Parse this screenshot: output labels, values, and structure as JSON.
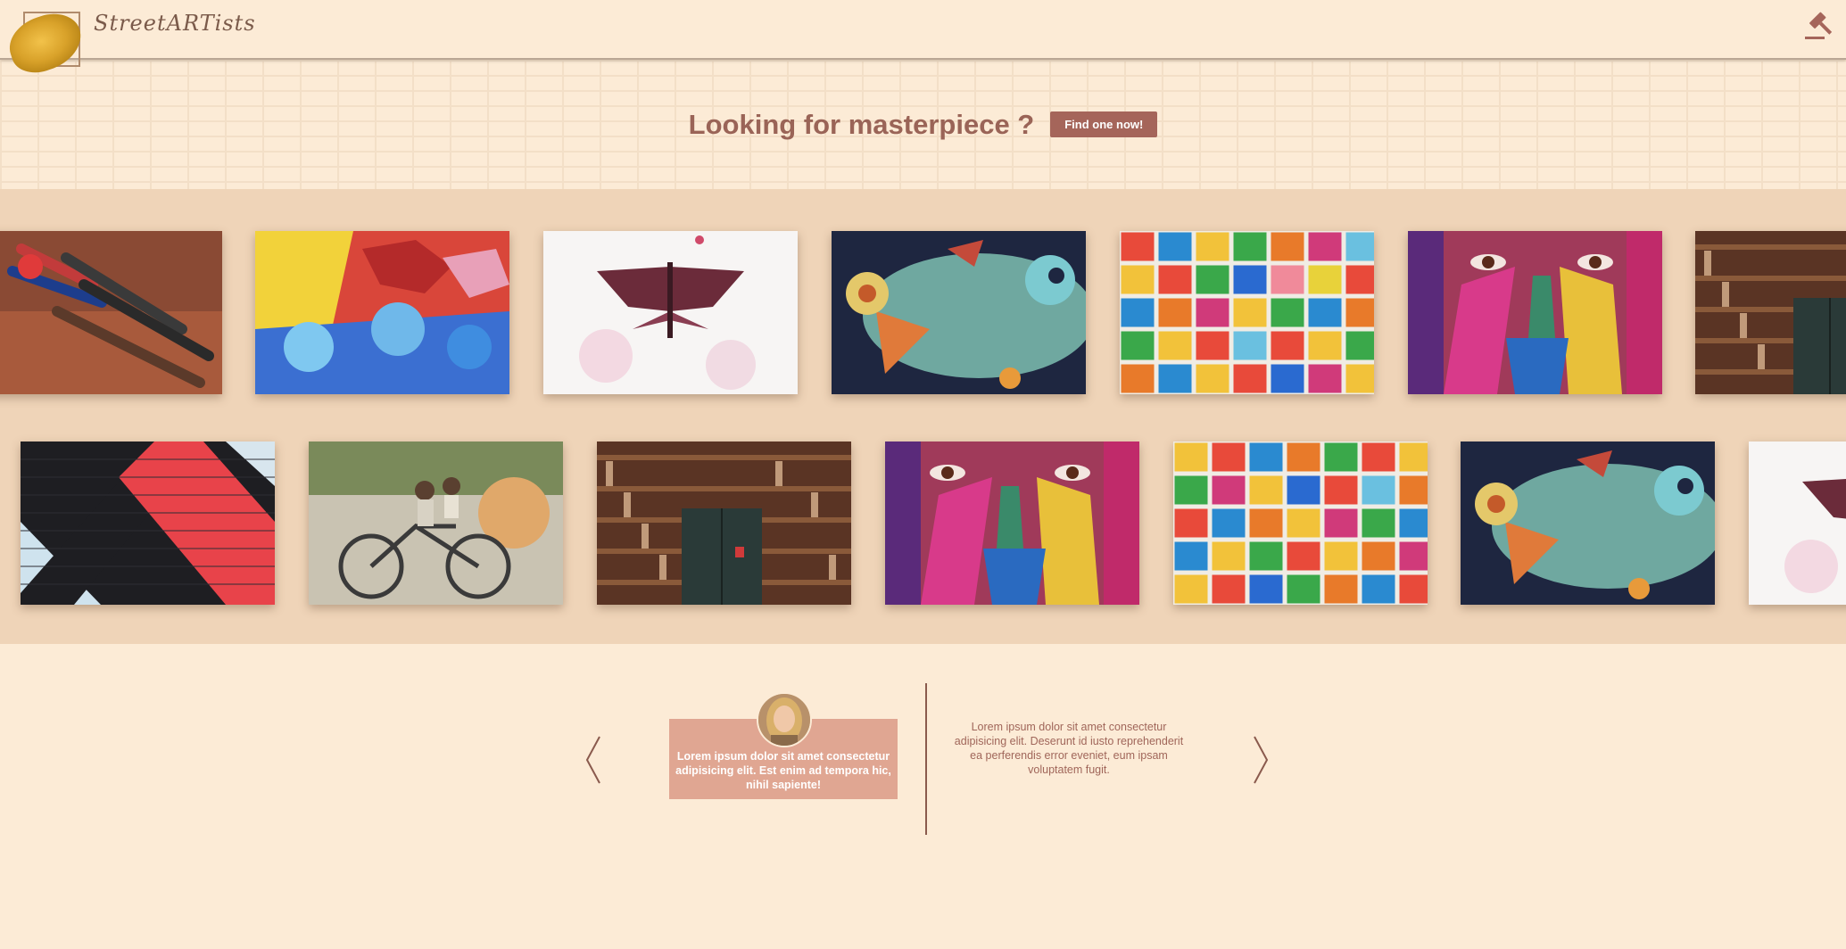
{
  "header": {
    "brand": "StreetARTists",
    "logo_icon": "paint-brush-logo-icon",
    "auction_icon": "gavel-icon"
  },
  "hero": {
    "title": "Looking for masterpiece ?",
    "cta_label": "Find one now!"
  },
  "gallery": {
    "row1": [
      {
        "subject": "paint-brushes"
      },
      {
        "subject": "graffiti-mural"
      },
      {
        "subject": "moth-watercolor"
      },
      {
        "subject": "fish-mosaic"
      },
      {
        "subject": "tile-mosaic"
      },
      {
        "subject": "painted-face"
      },
      {
        "subject": "bookshelf-door"
      }
    ],
    "row2": [
      {
        "subject": "striped-brick-wall"
      },
      {
        "subject": "kids-on-bicycle-mural"
      },
      {
        "subject": "bookshelf-door"
      },
      {
        "subject": "painted-face"
      },
      {
        "subject": "tile-mosaic"
      },
      {
        "subject": "fish-mosaic"
      },
      {
        "subject": "moth-watercolor"
      }
    ]
  },
  "testimonials": {
    "prev_icon": "chevron-left-icon",
    "next_icon": "chevron-right-icon",
    "active_quote": "Lorem ipsum dolor sit amet consectetur adipisicing elit. Est enim ad tempora hic, nihil sapiente!",
    "second_quote": "Lorem ipsum dolor sit amet consectetur adipisicing elit. Deserunt id iusto reprehenderit ea perferendis error eveniet, eum ipsam voluptatem fugit."
  },
  "colors": {
    "background": "#fcebd6",
    "gallery_bg": "#efd4b8",
    "accent": "#a5655a",
    "title": "#9a6457",
    "card": "#e0a692"
  }
}
